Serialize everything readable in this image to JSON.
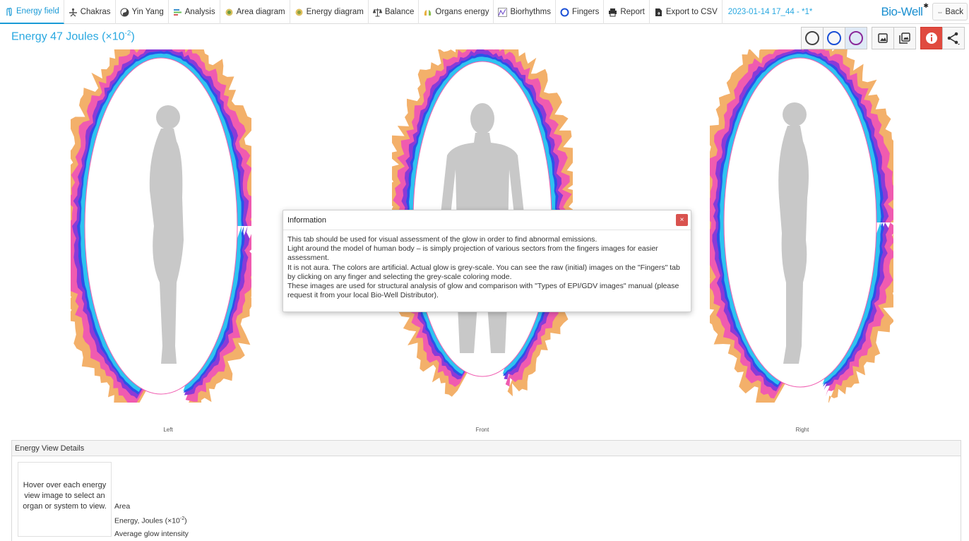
{
  "tabs": [
    {
      "label": "Energy field",
      "icon": "hand-icon",
      "active": true
    },
    {
      "label": "Chakras",
      "icon": "chakra-person-icon",
      "active": false
    },
    {
      "label": "Yin Yang",
      "icon": "yin-yang-icon",
      "active": false
    },
    {
      "label": "Analysis",
      "icon": "analysis-bars-icon",
      "active": false
    },
    {
      "label": "Area diagram",
      "icon": "area-diagram-icon",
      "active": false
    },
    {
      "label": "Energy diagram",
      "icon": "energy-diagram-icon",
      "active": false
    },
    {
      "label": "Balance",
      "icon": "balance-icon",
      "active": false
    },
    {
      "label": "Organs energy",
      "icon": "organs-icon",
      "active": false
    },
    {
      "label": "Biorhythms",
      "icon": "biorhythms-icon",
      "active": false
    },
    {
      "label": "Fingers",
      "icon": "fingers-ring-icon",
      "active": false
    },
    {
      "label": "Report",
      "icon": "printer-icon",
      "active": false
    },
    {
      "label": "Export to CSV",
      "icon": "export-file-icon",
      "active": false
    }
  ],
  "session_label": "2023-01-14 17_44 - *1*",
  "logo_text": "Bio-Well",
  "back_label": "Back",
  "energy": {
    "prefix": "Energy 47 Joules (×10",
    "exponent": "-2",
    "suffix": ")"
  },
  "figures": [
    {
      "label": "Left"
    },
    {
      "label": "Front"
    },
    {
      "label": "Right"
    }
  ],
  "dialog": {
    "title": "Information",
    "close": "×",
    "lines": [
      "This tab should be used for visual assessment of the glow in order to find abnormal emissions.",
      "Light around the model of human body – is simply projection of various sectors from the fingers images for easier assessment.",
      "It is not aura. The colors are artificial. Actual glow is grey-scale. You can see the raw (initial) images on the \"Fingers\" tab by clicking on any finger and selecting the grey-scale coloring mode.",
      "These images are used for structural analysis of glow and comparison with \"Types of EPI/GDV images\" manual (please request it from your local Bio-Well Distributor)."
    ]
  },
  "details": {
    "title": "Energy View Details",
    "hover_text": "Hover over each energy view image to select an organ or system to view.",
    "row_area": "Area",
    "row_energy_prefix": "Energy, Joules (×10",
    "row_energy_exp": "-2",
    "row_energy_suffix": ")",
    "row_glow": "Average glow intensity"
  },
  "colors": {
    "accent": "#29a8e0",
    "glow_outer": "#f3b06a",
    "glow_pink": "#f05bb0",
    "glow_purple": "#8a3ad8",
    "glow_blue": "#2a52e8",
    "glow_cyan": "#2ec3f0",
    "silhouette": "#c8c8c8"
  }
}
